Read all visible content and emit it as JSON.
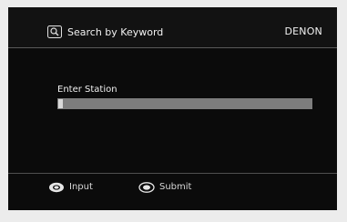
{
  "header": {
    "title": "Search by Keyword",
    "brand": "DENON",
    "title_icon": "search-keyword-icon"
  },
  "main": {
    "field_label": "Enter Station",
    "field_value": ""
  },
  "footer": {
    "hints": [
      {
        "icon": "cursor-pad-icon",
        "label": "Input"
      },
      {
        "icon": "enter-button-icon",
        "label": "Submit"
      }
    ]
  },
  "colors": {
    "screen_bg": "#0b0b0b",
    "page_bg": "#ececec",
    "input_bar": "#7d7d7d",
    "text": "#f2f2f2"
  }
}
